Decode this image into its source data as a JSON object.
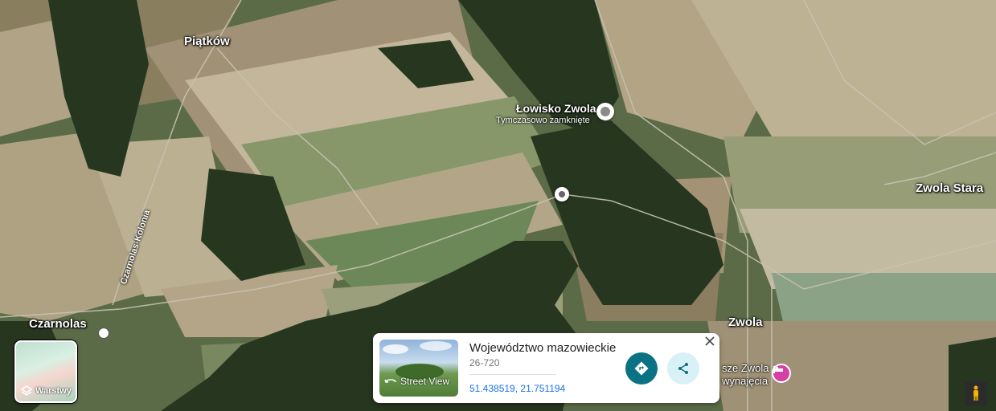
{
  "map": {
    "places": {
      "piatkow": "Piątków",
      "lowisko": "Łowisko Zwola",
      "lowisko_status": "Tymczasowo zamknięte",
      "zwola_stara": "Zwola Stara",
      "czarnolas": "Czarnolas",
      "zwola": "Zwola",
      "czarnolas_kolonia": "Czarnolas-Kolonia",
      "hotel_line1": "sze Zwola",
      "hotel_line2": "wynajęcia"
    }
  },
  "layers_button": {
    "label": "Warstwy",
    "icon": "layers-icon"
  },
  "place_card": {
    "title": "Województwo mazowieckie",
    "postal_code": "26-720",
    "coordinates": "51.438519, 21.751194",
    "street_view_label": "Street View",
    "directions_icon": "directions-icon",
    "share_icon": "share-icon",
    "close_icon": "close-icon"
  },
  "colors": {
    "directions_button": "#0b7285",
    "share_button": "#d8f1f7",
    "coords_link": "#1a73e8",
    "hotel_pin": "#d63fa3"
  }
}
